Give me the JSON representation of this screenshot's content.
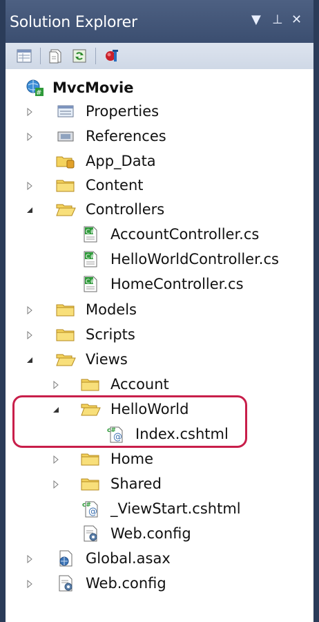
{
  "window": {
    "title": "Solution Explorer",
    "controls": [
      "▼",
      "⊥",
      "✕"
    ]
  },
  "toolbar": {
    "buttons": [
      {
        "name": "properties",
        "icon": "properties-grid-icon"
      },
      {
        "name": "show-all-files",
        "icon": "show-all-files-icon"
      },
      {
        "name": "refresh",
        "icon": "refresh-icon"
      },
      {
        "name": "view-class-diagram",
        "icon": "class-diagram-icon"
      }
    ]
  },
  "tree": [
    {
      "label": "MvcMovie",
      "type": "project",
      "bold": true,
      "expanded": true
    },
    {
      "label": "Properties",
      "type": "properties",
      "expanded": false
    },
    {
      "label": "References",
      "type": "references",
      "expanded": false
    },
    {
      "label": "App_Data",
      "type": "folder-special"
    },
    {
      "label": "Content",
      "type": "folder",
      "expanded": false
    },
    {
      "label": "Controllers",
      "type": "folder-open",
      "expanded": true
    },
    {
      "label": "AccountController.cs",
      "type": "cs-file"
    },
    {
      "label": "HelloWorldController.cs",
      "type": "cs-file"
    },
    {
      "label": "HomeController.cs",
      "type": "cs-file"
    },
    {
      "label": "Models",
      "type": "folder",
      "expanded": false
    },
    {
      "label": "Scripts",
      "type": "folder",
      "expanded": false
    },
    {
      "label": "Views",
      "type": "folder-open",
      "expanded": true
    },
    {
      "label": "Account",
      "type": "folder",
      "expanded": false
    },
    {
      "label": "HelloWorld",
      "type": "folder-open",
      "expanded": true
    },
    {
      "label": "Index.cshtml",
      "type": "cshtml-file"
    },
    {
      "label": "Home",
      "type": "folder",
      "expanded": false
    },
    {
      "label": "Shared",
      "type": "folder",
      "expanded": false
    },
    {
      "label": "_ViewStart.cshtml",
      "type": "cshtml-file"
    },
    {
      "label": "Web.config",
      "type": "config-file"
    },
    {
      "label": "Global.asax",
      "type": "asax-file",
      "expanded": false
    },
    {
      "label": "Web.config",
      "type": "config-file",
      "expanded": false
    }
  ],
  "colors": {
    "titlebar": "#3b4e70",
    "frame": "#2b3c59",
    "highlight": "#c81e4a",
    "folder": "#f4d35e"
  }
}
